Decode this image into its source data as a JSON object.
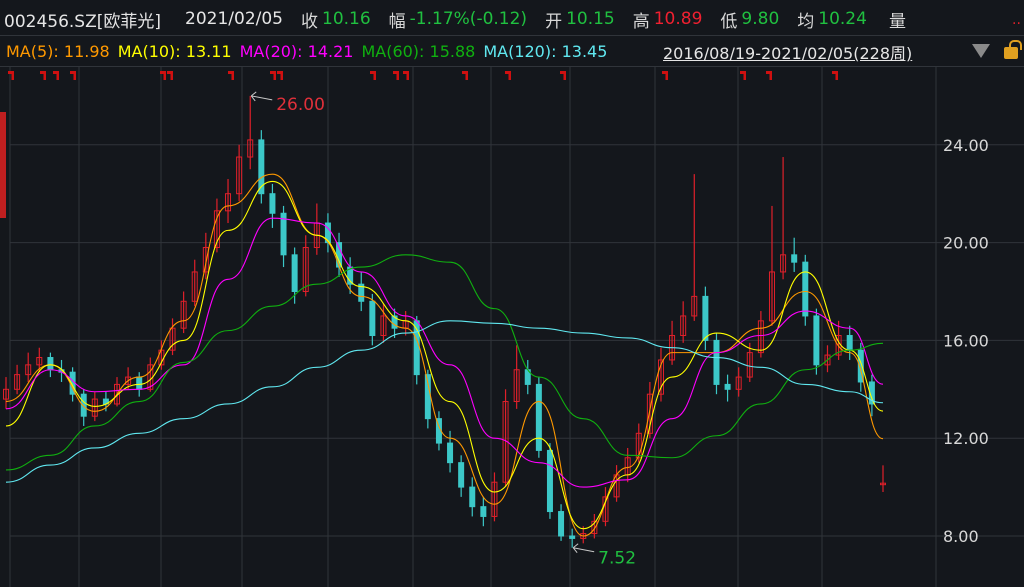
{
  "header": {
    "symbol": "002456.SZ[欧菲光]",
    "date": "2021/02/05",
    "close_label": "收",
    "close": "10.16",
    "change_label": "幅",
    "change": "-1.17%(-0.12)",
    "open_label": "开",
    "open": "10.15",
    "high_label": "高",
    "high": "10.89",
    "low_label": "低",
    "low": "9.80",
    "avg_label": "均",
    "avg": "10.24",
    "volume_label": "量",
    "more": ".."
  },
  "ma_bar": {
    "ma5": "MA(5): 11.98",
    "ma10": "MA(10): 13.11",
    "ma20": "MA(20): 14.21",
    "ma60": "MA(60): 15.88",
    "ma120": "MA(120): 13.45",
    "range": "2016/08/19-2021/02/05(228周)",
    "dropdown_icon": "triangle-down-icon",
    "lock_icon": "lock-icon"
  },
  "colors": {
    "background": "#14171c",
    "grid": "#30343a",
    "up": "#e0202a",
    "down": "#3cc8c8",
    "ma5": "#ff9900",
    "ma10": "#ffff00",
    "ma20": "#ff00ff",
    "ma60": "#10b010",
    "ma120": "#60e8f0",
    "max_label": "#e0303a",
    "min_label": "#20c040"
  },
  "chart_data": {
    "type": "candlestick",
    "ylim": [
      6.2,
      27.4
    ],
    "yticks": [
      "24.00",
      "20.00",
      "16.00",
      "12.00",
      "8.00"
    ],
    "ytick_values": [
      24,
      20,
      16,
      12,
      8
    ],
    "grid": true,
    "annotations": {
      "max": "26.00",
      "min": "7.52"
    },
    "ohlc": [
      [
        13.6,
        14.5,
        13.2,
        14.0
      ],
      [
        14.0,
        15.0,
        13.8,
        14.6
      ],
      [
        14.6,
        15.5,
        14.3,
        15.0
      ],
      [
        15.0,
        15.7,
        14.7,
        15.3
      ],
      [
        15.3,
        15.5,
        14.5,
        14.8
      ],
      [
        14.8,
        15.2,
        14.3,
        14.7
      ],
      [
        14.7,
        14.9,
        13.5,
        13.8
      ],
      [
        13.8,
        14.0,
        12.5,
        12.9
      ],
      [
        12.9,
        13.9,
        12.7,
        13.6
      ],
      [
        13.6,
        13.9,
        13.1,
        13.4
      ],
      [
        13.4,
        14.5,
        13.3,
        14.2
      ],
      [
        14.2,
        14.9,
        14.0,
        14.5
      ],
      [
        14.5,
        14.7,
        13.7,
        14.0
      ],
      [
        14.0,
        15.3,
        13.9,
        15.0
      ],
      [
        15.0,
        16.0,
        14.8,
        15.6
      ],
      [
        15.6,
        16.9,
        15.4,
        16.5
      ],
      [
        16.5,
        18.0,
        16.3,
        17.6
      ],
      [
        17.6,
        19.3,
        17.4,
        18.8
      ],
      [
        18.8,
        20.4,
        18.5,
        19.8
      ],
      [
        19.8,
        21.8,
        19.6,
        21.3
      ],
      [
        21.3,
        22.6,
        20.8,
        22.0
      ],
      [
        22.0,
        24.0,
        21.7,
        23.5
      ],
      [
        23.5,
        26.0,
        23.0,
        24.2
      ],
      [
        24.2,
        24.6,
        21.6,
        22.0
      ],
      [
        22.0,
        22.4,
        20.6,
        21.2
      ],
      [
        21.2,
        21.5,
        19.0,
        19.5
      ],
      [
        19.5,
        19.8,
        17.5,
        18.0
      ],
      [
        18.0,
        20.3,
        17.8,
        19.8
      ],
      [
        19.8,
        21.6,
        19.5,
        20.8
      ],
      [
        20.8,
        21.2,
        19.6,
        20.0
      ],
      [
        20.0,
        20.4,
        18.6,
        19.0
      ],
      [
        19.0,
        19.4,
        17.9,
        18.3
      ],
      [
        18.3,
        18.8,
        17.2,
        17.6
      ],
      [
        17.6,
        17.9,
        15.8,
        16.2
      ],
      [
        16.2,
        17.5,
        15.9,
        17.0
      ],
      [
        17.0,
        17.3,
        16.1,
        16.5
      ],
      [
        16.5,
        17.2,
        16.2,
        16.8
      ],
      [
        16.8,
        17.0,
        14.2,
        14.6
      ],
      [
        14.6,
        14.8,
        12.4,
        12.8
      ],
      [
        12.8,
        13.1,
        11.5,
        11.8
      ],
      [
        11.8,
        12.3,
        10.6,
        11.0
      ],
      [
        11.0,
        11.3,
        9.6,
        10.0
      ],
      [
        10.0,
        10.4,
        8.8,
        9.2
      ],
      [
        9.2,
        9.6,
        8.4,
        8.8
      ],
      [
        8.8,
        10.6,
        8.6,
        10.2
      ],
      [
        10.2,
        14.0,
        10.0,
        13.5
      ],
      [
        13.5,
        15.8,
        13.2,
        14.8
      ],
      [
        14.8,
        15.2,
        13.8,
        14.2
      ],
      [
        14.2,
        14.5,
        11.2,
        11.5
      ],
      [
        11.5,
        11.8,
        8.7,
        9.0
      ],
      [
        9.0,
        9.3,
        7.8,
        8.0
      ],
      [
        8.0,
        8.3,
        7.52,
        7.9
      ],
      [
        7.9,
        8.4,
        7.7,
        8.1
      ],
      [
        8.1,
        8.9,
        7.9,
        8.6
      ],
      [
        8.6,
        10.0,
        8.4,
        9.6
      ],
      [
        9.6,
        10.9,
        9.4,
        10.5
      ],
      [
        10.5,
        11.6,
        10.2,
        11.2
      ],
      [
        11.2,
        12.6,
        11.0,
        12.2
      ],
      [
        12.2,
        14.3,
        12.0,
        13.8
      ],
      [
        13.8,
        15.7,
        13.5,
        15.2
      ],
      [
        15.2,
        16.8,
        15.0,
        16.2
      ],
      [
        16.2,
        17.6,
        15.9,
        17.0
      ],
      [
        17.0,
        22.8,
        16.8,
        17.8
      ],
      [
        17.8,
        18.2,
        15.6,
        16.0
      ],
      [
        16.0,
        16.3,
        13.8,
        14.2
      ],
      [
        14.2,
        14.6,
        13.5,
        14.0
      ],
      [
        14.0,
        14.9,
        13.7,
        14.5
      ],
      [
        14.5,
        15.9,
        14.3,
        15.5
      ],
      [
        15.5,
        17.2,
        15.3,
        16.8
      ],
      [
        16.8,
        21.5,
        16.6,
        18.8
      ],
      [
        18.8,
        23.5,
        18.5,
        19.5
      ],
      [
        19.5,
        20.2,
        18.8,
        19.2
      ],
      [
        19.2,
        19.5,
        16.6,
        17.0
      ],
      [
        17.0,
        17.3,
        14.6,
        15.0
      ],
      [
        15.0,
        15.8,
        14.7,
        15.4
      ],
      [
        15.4,
        16.8,
        15.2,
        16.2
      ],
      [
        16.2,
        16.6,
        15.2,
        15.6
      ],
      [
        15.6,
        15.9,
        13.9,
        14.3
      ],
      [
        14.3,
        14.6,
        12.9,
        13.4
      ],
      [
        10.15,
        10.89,
        9.8,
        10.16
      ]
    ],
    "ma_sample_every": 4,
    "series": [
      {
        "name": "MA(5)",
        "values": [
          13.5,
          15.0,
          13.1,
          14.5,
          16.8,
          21.5,
          22.8,
          20.3,
          17.8,
          16.5,
          12.0,
          9.3,
          13.5,
          8.0,
          10.8,
          15.5,
          15.5,
          16.5,
          18.0,
          15.5,
          11.98
        ]
      },
      {
        "name": "MA(10)",
        "values": [
          12.5,
          15.0,
          13.3,
          14.2,
          16.0,
          20.5,
          22.5,
          20.3,
          18.2,
          16.8,
          13.5,
          9.8,
          12.0,
          8.3,
          10.5,
          14.5,
          16.3,
          15.6,
          18.8,
          15.6,
          13.11
        ]
      },
      {
        "name": "MA(20)",
        "values": [
          13.2,
          14.8,
          13.9,
          14.0,
          15.0,
          18.5,
          21.0,
          20.8,
          18.8,
          17.0,
          15.0,
          12.0,
          11.0,
          10.0,
          10.3,
          12.8,
          15.5,
          16.2,
          17.2,
          16.5,
          14.21
        ]
      },
      {
        "name": "MA(60)",
        "values": [
          10.7,
          11.3,
          12.5,
          13.5,
          15.1,
          16.4,
          17.4,
          18.3,
          19.0,
          19.5,
          19.2,
          17.3,
          14.5,
          12.8,
          11.3,
          11.2,
          12.1,
          13.4,
          14.8,
          15.6,
          15.88
        ]
      },
      {
        "name": "MA(120)",
        "values": [
          10.2,
          10.9,
          11.6,
          12.2,
          12.8,
          13.4,
          14.1,
          14.9,
          15.6,
          16.3,
          16.8,
          16.7,
          16.5,
          16.3,
          16.1,
          15.7,
          15.3,
          14.9,
          14.2,
          13.9,
          13.45
        ]
      }
    ]
  }
}
